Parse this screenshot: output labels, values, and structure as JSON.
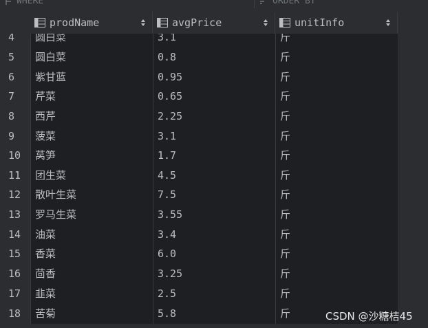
{
  "filter": {
    "where_label": "WHERE",
    "order_label": "ORDER BY"
  },
  "columns": [
    {
      "name": "prodName",
      "icon": "table-column-icon"
    },
    {
      "name": "avgPrice",
      "icon": "table-column-icon"
    },
    {
      "name": "unitInfo",
      "icon": "table-column-icon"
    }
  ],
  "rows": [
    {
      "num": "4",
      "prodName": "圆白菜",
      "avgPrice": "3.1",
      "unitInfo": "斤"
    },
    {
      "num": "5",
      "prodName": "圆白菜",
      "avgPrice": "0.8",
      "unitInfo": "斤"
    },
    {
      "num": "6",
      "prodName": "紫甘蓝",
      "avgPrice": "0.95",
      "unitInfo": "斤"
    },
    {
      "num": "7",
      "prodName": "芹菜",
      "avgPrice": "0.65",
      "unitInfo": "斤"
    },
    {
      "num": "8",
      "prodName": "西芹",
      "avgPrice": "2.25",
      "unitInfo": "斤"
    },
    {
      "num": "9",
      "prodName": "菠菜",
      "avgPrice": "3.1",
      "unitInfo": "斤"
    },
    {
      "num": "10",
      "prodName": "莴笋",
      "avgPrice": "1.7",
      "unitInfo": "斤"
    },
    {
      "num": "11",
      "prodName": "团生菜",
      "avgPrice": "4.5",
      "unitInfo": "斤"
    },
    {
      "num": "12",
      "prodName": "散叶生菜",
      "avgPrice": "7.5",
      "unitInfo": "斤"
    },
    {
      "num": "13",
      "prodName": "罗马生菜",
      "avgPrice": "3.55",
      "unitInfo": "斤"
    },
    {
      "num": "14",
      "prodName": "油菜",
      "avgPrice": "3.4",
      "unitInfo": "斤"
    },
    {
      "num": "15",
      "prodName": "香菜",
      "avgPrice": "6.0",
      "unitInfo": "斤"
    },
    {
      "num": "16",
      "prodName": "茴香",
      "avgPrice": "3.25",
      "unitInfo": "斤"
    },
    {
      "num": "17",
      "prodName": "韭菜",
      "avgPrice": "2.5",
      "unitInfo": "斤"
    },
    {
      "num": "18",
      "prodName": "苦菊",
      "avgPrice": "5.8",
      "unitInfo": "斤"
    }
  ],
  "watermark": "CSDN @沙糖桔45"
}
